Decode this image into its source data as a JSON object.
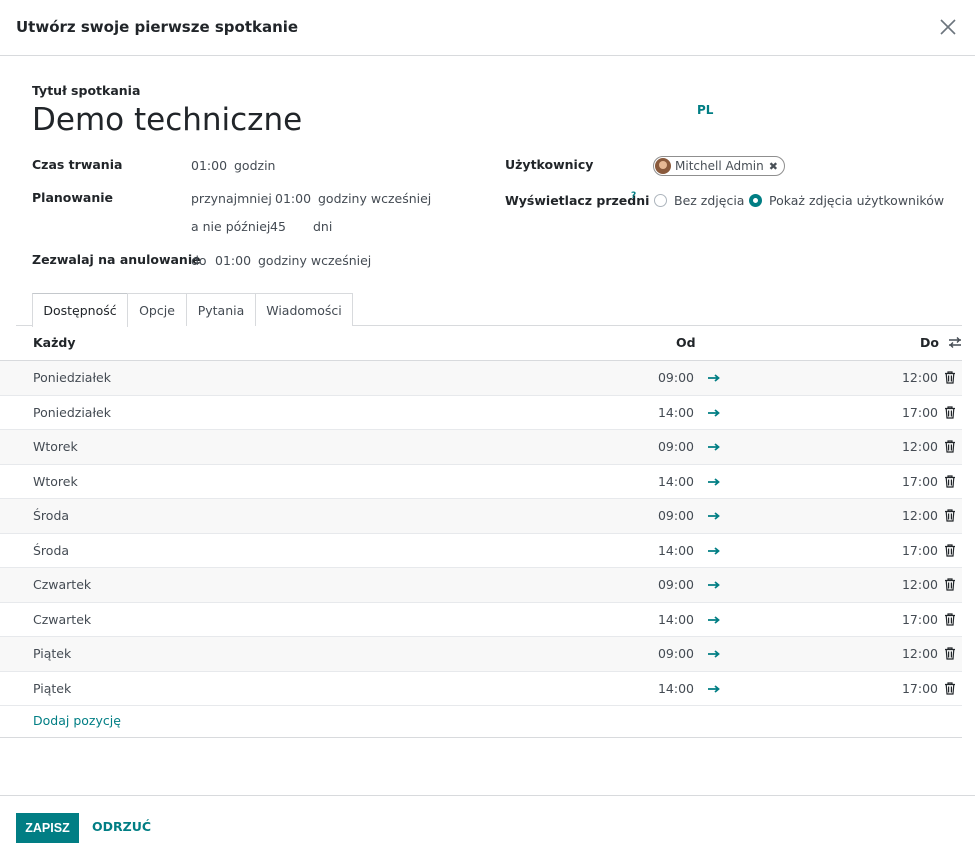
{
  "dialog": {
    "title": "Utwórz swoje pierwsze spotkanie",
    "close_icon": "close-icon"
  },
  "form": {
    "title_label": "Tytuł spotkania",
    "title_value": "Demo techniczne",
    "lang_label": "PL",
    "duration": {
      "label": "Czas trwania",
      "value": "01:00",
      "unit": "godzin"
    },
    "scheduling": {
      "label": "Planowanie",
      "min_prefix": "przynajmniej",
      "min_value": "01:00",
      "min_unit": "godziny wcześniej",
      "max_prefix": "a nie później",
      "max_value": "45",
      "max_unit": "dni"
    },
    "cancel": {
      "label": "Zezwalaj na anulowanie",
      "prefix": "do",
      "value": "01:00",
      "unit": "godziny wcześniej"
    },
    "users": {
      "label": "Użytkownicy",
      "tag": "Mitchell Admin"
    },
    "front_display": {
      "label": "Wyświetlacz przedni",
      "help_mark": "?",
      "options": [
        "Bez zdjęcia",
        "Pokaż zdjęcia użytkowników"
      ],
      "selected": 1
    }
  },
  "tabs": [
    {
      "label": "Dostępność",
      "active": true
    },
    {
      "label": "Opcje",
      "active": false
    },
    {
      "label": "Pytania",
      "active": false
    },
    {
      "label": "Wiadomości",
      "active": false
    }
  ],
  "table": {
    "headers": {
      "day": "Każdy",
      "from": "Od",
      "to": "Do"
    },
    "rows": [
      {
        "day": "Poniedziałek",
        "from": "09:00",
        "to": "12:00"
      },
      {
        "day": "Poniedziałek",
        "from": "14:00",
        "to": "17:00"
      },
      {
        "day": "Wtorek",
        "from": "09:00",
        "to": "12:00"
      },
      {
        "day": "Wtorek",
        "from": "14:00",
        "to": "17:00"
      },
      {
        "day": "Środa",
        "from": "09:00",
        "to": "12:00"
      },
      {
        "day": "Środa",
        "from": "14:00",
        "to": "17:00"
      },
      {
        "day": "Czwartek",
        "from": "09:00",
        "to": "12:00"
      },
      {
        "day": "Czwartek",
        "from": "14:00",
        "to": "17:00"
      },
      {
        "day": "Piątek",
        "from": "09:00",
        "to": "12:00"
      },
      {
        "day": "Piątek",
        "from": "14:00",
        "to": "17:00"
      }
    ],
    "add_line": "Dodaj pozycję"
  },
  "footer": {
    "save_label": "ZAPISZ",
    "discard_label": "ODRZUĆ"
  },
  "colors": {
    "accent": "#017e84",
    "border": "#d8dadd",
    "text": "#212529"
  }
}
